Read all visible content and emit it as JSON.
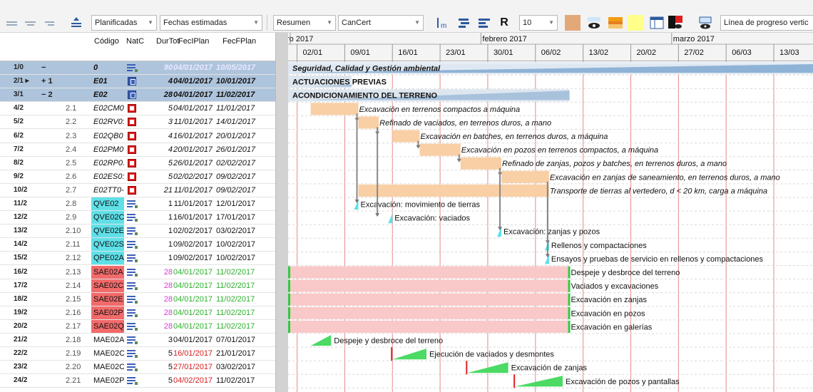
{
  "toolbar": {
    "filter": "Planificadas",
    "dates": "Fechas estimadas",
    "view": "Resumen",
    "field": "CanCert",
    "zoom": "10",
    "progress": "Línea de progreso vertic",
    "r_label": "R"
  },
  "columns": {
    "code": "Código",
    "nat": "NatC",
    "dur": "DurTot",
    "fini": "FecIPlan",
    "ffin": "FecFPlan"
  },
  "timeline": {
    "months": [
      {
        "label": "ro 2017",
        "day": 0
      },
      {
        "label": "febrero 2017",
        "day": 28
      },
      {
        "label": "marzo 2017",
        "day": 56
      }
    ],
    "weeks": [
      "02/01",
      "09/01",
      "16/01",
      "23/01",
      "30/01",
      "06/02",
      "13/02",
      "20/02",
      "27/02",
      "06/03",
      "13/03"
    ]
  },
  "rows": [
    {
      "id": "1/0",
      "toggle": "−",
      "lvl": "",
      "code": "0",
      "nat": "lines",
      "dur": "90",
      "d1": "04/01/2017",
      "d2": "10/05/2017",
      "type": "root",
      "bar": {
        "kind": "summary",
        "s": 3,
        "e": 128
      },
      "label": "Seguridad, Calidad y Gestión ambiental",
      "lstyle": "bd"
    },
    {
      "id": "2/1 ▸",
      "toggle": "+ 1",
      "lvl": "",
      "code": "E01",
      "nat": "blue",
      "dur": "4",
      "d1": "04/01/2017",
      "d2": "10/01/2017",
      "type": "summary",
      "bar": {
        "kind": "summary",
        "s": 3,
        "e": 9
      },
      "label": "ACTUACIONES PREVIAS",
      "lstyle": "bd"
    },
    {
      "id": "3/1",
      "toggle": "− 2",
      "lvl": "",
      "code": "E02",
      "nat": "blue",
      "dur": "28",
      "d1": "04/01/2017",
      "d2": "11/02/2017",
      "type": "summary",
      "bar": {
        "kind": "summary",
        "s": 3,
        "e": 41
      },
      "label": "ACONDICIONAMIENTO DEL TERRENO",
      "lstyle": "bd"
    },
    {
      "id": "4/2",
      "lvl": "2.1",
      "code": "E02CM0",
      "nat": "red",
      "dur": "5",
      "d1": "04/01/2017",
      "d2": "11/01/2017",
      "type": "task",
      "bar": {
        "kind": "orange",
        "s": 3,
        "e": 10
      },
      "label": "Excavación en terrenos compactos a máquina",
      "lstyle": "it"
    },
    {
      "id": "5/2",
      "lvl": "2.2",
      "code": "E02RV0:",
      "nat": "red",
      "dur": "3",
      "d1": "11/01/2017",
      "d2": "14/01/2017",
      "type": "task",
      "bar": {
        "kind": "orange",
        "s": 10,
        "e": 13
      },
      "label": "Refinado de vaciados, en terrenos duros, a mano",
      "lstyle": "it"
    },
    {
      "id": "6/2",
      "lvl": "2.3",
      "code": "E02QB0",
      "nat": "red",
      "dur": "4",
      "d1": "16/01/2017",
      "d2": "20/01/2017",
      "type": "task",
      "bar": {
        "kind": "orange",
        "s": 15,
        "e": 19
      },
      "label": "Excavación en batches, en terrenos duros, a máquina",
      "lstyle": "it"
    },
    {
      "id": "7/2",
      "lvl": "2.4",
      "code": "E02PM0",
      "nat": "red",
      "dur": "4",
      "d1": "20/01/2017",
      "d2": "26/01/2017",
      "type": "task",
      "bar": {
        "kind": "orange",
        "s": 19,
        "e": 25
      },
      "label": "Excavación en pozos en terrenos compactos, a máquina",
      "lstyle": "it"
    },
    {
      "id": "8/2",
      "lvl": "2.5",
      "code": "E02RP0.",
      "nat": "red",
      "dur": "5",
      "d1": "26/01/2017",
      "d2": "02/02/2017",
      "type": "task",
      "bar": {
        "kind": "orange",
        "s": 25,
        "e": 31
      },
      "label": "Refinado de zanjas, pozos y batches, en terrenos duros, a mano",
      "lstyle": "it"
    },
    {
      "id": "9/2",
      "lvl": "2.6",
      "code": "E02ES0:",
      "nat": "red",
      "dur": "5",
      "d1": "02/02/2017",
      "d2": "09/02/2017",
      "type": "task",
      "bar": {
        "kind": "orange",
        "s": 31,
        "e": 38
      },
      "label": "Excavación en zanjas de saneamiento, en terrenos duros, a mano",
      "lstyle": "it"
    },
    {
      "id": "10/2",
      "lvl": "2.7",
      "code": "E02TT0-",
      "nat": "red",
      "dur": "21",
      "d1": "11/01/2017",
      "d2": "09/02/2017",
      "type": "task",
      "bar": {
        "kind": "orange",
        "s": 10,
        "e": 38
      },
      "label": "Transporte de tierras al vertedero, d < 20 km, carga a máquina",
      "lstyle": "it"
    },
    {
      "id": "11/2",
      "lvl": "2.8",
      "code": "QVE02",
      "nat": "lines",
      "dur": "1",
      "d1": "11/01/2017",
      "d2": "12/01/2017",
      "type": "cyan",
      "bar": {
        "kind": "milestone",
        "s": 10,
        "e": 11
      },
      "label": "Excavación: movimiento de tierras",
      "lstyle": ""
    },
    {
      "id": "12/2",
      "lvl": "2.9",
      "code": "QVE02C",
      "nat": "lines",
      "dur": "1",
      "d1": "16/01/2017",
      "d2": "17/01/2017",
      "type": "cyan",
      "bar": {
        "kind": "milestone",
        "s": 15,
        "e": 16
      },
      "label": "Excavación: vaciados",
      "lstyle": ""
    },
    {
      "id": "13/2",
      "lvl": "2.10",
      "code": "QVE02E",
      "nat": "lines",
      "dur": "1",
      "d1": "02/02/2017",
      "d2": "03/02/2017",
      "type": "cyan",
      "bar": {
        "kind": "milestone",
        "s": 31,
        "e": 32
      },
      "label": "Excavación: zanjas y pozos",
      "lstyle": ""
    },
    {
      "id": "14/2",
      "lvl": "2.11",
      "code": "QVE02S",
      "nat": "lines",
      "dur": "1",
      "d1": "09/02/2017",
      "d2": "10/02/2017",
      "type": "cyan",
      "bar": {
        "kind": "milestone",
        "s": 38,
        "e": 39
      },
      "label": "Rellenos y compactaciones",
      "lstyle": ""
    },
    {
      "id": "15/2",
      "lvl": "2.12",
      "code": "QPE02A",
      "nat": "lines",
      "dur": "1",
      "d1": "09/02/2017",
      "d2": "10/02/2017",
      "type": "cyan",
      "bar": {
        "kind": "milestone",
        "s": 38,
        "e": 39
      },
      "label": "Ensayos y pruebas de servicio en rellenos y compactaciones",
      "lstyle": ""
    },
    {
      "id": "16/2",
      "lvl": "2.13",
      "code": "SAE02A",
      "nat": "lines",
      "dur": "28",
      "d1": "04/01/2017",
      "d2": "11/02/2017",
      "type": "red",
      "bar": {
        "kind": "pink",
        "s": 3,
        "e": 41
      },
      "label": "Despeje y desbroce del terreno",
      "lstyle": ""
    },
    {
      "id": "17/2",
      "lvl": "2.14",
      "code": "SAE02C",
      "nat": "lines",
      "dur": "28",
      "d1": "04/01/2017",
      "d2": "11/02/2017",
      "type": "red",
      "bar": {
        "kind": "pink",
        "s": 3,
        "e": 41
      },
      "label": "Vaciados y excavaciones",
      "lstyle": ""
    },
    {
      "id": "18/2",
      "lvl": "2.15",
      "code": "SAE02E",
      "nat": "lines",
      "dur": "28",
      "d1": "04/01/2017",
      "d2": "11/02/2017",
      "type": "red",
      "bar": {
        "kind": "pink",
        "s": 3,
        "e": 41
      },
      "label": "Excavación en zanjas",
      "lstyle": ""
    },
    {
      "id": "19/2",
      "lvl": "2.16",
      "code": "SAE02P",
      "nat": "lines",
      "dur": "28",
      "d1": "04/01/2017",
      "d2": "11/02/2017",
      "type": "red",
      "bar": {
        "kind": "pink",
        "s": 3,
        "e": 41
      },
      "label": "Excavación en pozos",
      "lstyle": ""
    },
    {
      "id": "20/2",
      "lvl": "2.17",
      "code": "SAE02Q",
      "nat": "lines",
      "dur": "28",
      "d1": "04/01/2017",
      "d2": "11/02/2017",
      "type": "red",
      "bar": {
        "kind": "pink",
        "s": 3,
        "e": 41
      },
      "label": "Excavación en galerías",
      "lstyle": ""
    },
    {
      "id": "21/2",
      "lvl": "2.18",
      "code": "MAE02A",
      "nat": "lines",
      "dur": "3",
      "d1": "04/01/2017",
      "d2": "07/01/2017",
      "type": "plain",
      "bar": {
        "kind": "green",
        "s": 3,
        "e": 6
      },
      "label": "Despeje y desbroce del terreno",
      "lstyle": ""
    },
    {
      "id": "22/2",
      "lvl": "2.19",
      "code": "MAE02C",
      "nat": "lines",
      "dur": "5",
      "d1": "16/01/2017",
      "d2": "21/01/2017",
      "type": "plain",
      "bar": {
        "kind": "green",
        "s": 15,
        "e": 20
      },
      "label": "Ejecución de vaciados y desmontes",
      "lstyle": ""
    },
    {
      "id": "23/2",
      "lvl": "2.20",
      "code": "MAE02C",
      "nat": "lines",
      "dur": "5",
      "d1": "27/01/2017",
      "d2": "03/02/2017",
      "type": "plain",
      "bar": {
        "kind": "green",
        "s": 26,
        "e": 32
      },
      "label": "Excavación de zanjas",
      "lstyle": ""
    },
    {
      "id": "24/2",
      "lvl": "2.21",
      "code": "MAE02P",
      "nat": "lines",
      "dur": "5",
      "d1": "04/02/2017",
      "d2": "11/02/2017",
      "type": "plain",
      "bar": {
        "kind": "green",
        "s": 33,
        "e": 40
      },
      "label": "Excavación de pozos y pantallas",
      "lstyle": ""
    }
  ],
  "colors": {
    "summary": "#aec4dc",
    "orange": "#f9cfa5",
    "pink": "#f9c8c8",
    "green": "#4cd964",
    "cyan": "#5fe0e8",
    "redcode": "#f26a6a",
    "datepink": "#d43cd4",
    "weekline": "#e58a8a"
  }
}
